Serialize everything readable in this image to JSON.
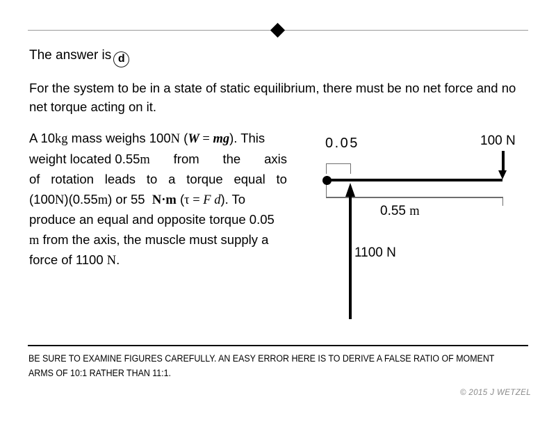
{
  "header": {
    "divider_icon": "diamond-bullet"
  },
  "answer": {
    "prefix": "The answer is",
    "choice": "d"
  },
  "intro": {
    "text": "For the system to be in a state of static equilibrium, there must be no net force and no net torque acting on it."
  },
  "explanation": {
    "full_text": "A 10kg mass weighs 100N (W = mg). This weight located 0.55m from the axis of rotation leads to a torque equal to (100N)(0.55m) or 55 N·m (τ = F d). To produce an equal and opposite torque 0.05 m from the axis, the muscle must supply a force of 1100 N.",
    "lines": [
      {
        "seg": [
          "A 10",
          "kg",
          " mass weighs 100",
          "N",
          " (",
          "W",
          " = ",
          "mg",
          "). This"
        ]
      }
    ],
    "l1_a": "A 10",
    "l1_kg": "kg",
    "l1_b": " mass weighs 100",
    "l1_n": "N",
    "l1_c": " (",
    "l1_w": "W",
    "l1_eq": " = ",
    "l1_mg": "mg",
    "l1_d": "). This",
    "l2_a": "weight located 0.55",
    "l2_m": "m",
    "l2_b": "from",
    "l2_c": "the",
    "l2_d": "axis",
    "l3_a": "of rotation leads to a torque equal to",
    "l3_w1": "of",
    "l3_w2": "rotation",
    "l3_w3": "leads",
    "l3_w4": "to",
    "l3_w5": "a",
    "l3_w6": "torque",
    "l3_w7": "equal",
    "l3_w8": "to",
    "l4_a": "(100",
    "l4_n1": "N",
    "l4_b": ")(0.55",
    "l4_m1": "m",
    "l4_c": ") or 55",
    "l4_nm": "N·m",
    "l4_d": "(",
    "l4_tau": "τ",
    "l4_eq": " = ",
    "l4_f": "F d",
    "l4_e": "). To",
    "l5": "produce an equal and opposite torque 0.05",
    "l6_m": "m",
    "l6_a": " from the axis, the muscle must supply a",
    "l7_a": "force of 1100 ",
    "l7_n": "N",
    "l7_b": "."
  },
  "diagram": {
    "label_short_distance": "0.05",
    "label_long_distance": "0.55",
    "label_long_distance_unit": "m",
    "label_load_force": "100 N",
    "label_muscle_force": "1100 N",
    "pivot_icon": "pivot-dot",
    "load_arrow_icon": "arrow-down-icon",
    "muscle_arrow_icon": "arrow-up-icon",
    "values": {
      "short_moment_arm_m": 0.05,
      "long_moment_arm_m": 0.55,
      "load_force_N": 100,
      "muscle_force_N": 1100,
      "torque_N_m": 55,
      "mass_kg": 10,
      "moment_arm_ratio": "11:1"
    }
  },
  "footer": {
    "note": "BE SURE TO EXAMINE FIGURES CAREFULLY.  AN EASY ERROR HERE IS TO DERIVE A FALSE RATIO OF MOMENT ARMS OF 10:1 RATHER THAN 11:1.",
    "copyright": "© 2015 J WETZEL"
  },
  "colors": {
    "text": "#000000",
    "rule_top": "#9a9a9a",
    "rule_bottom": "#000000",
    "bracket": "#6e6e6e",
    "copyright": "#8a8a8a"
  }
}
